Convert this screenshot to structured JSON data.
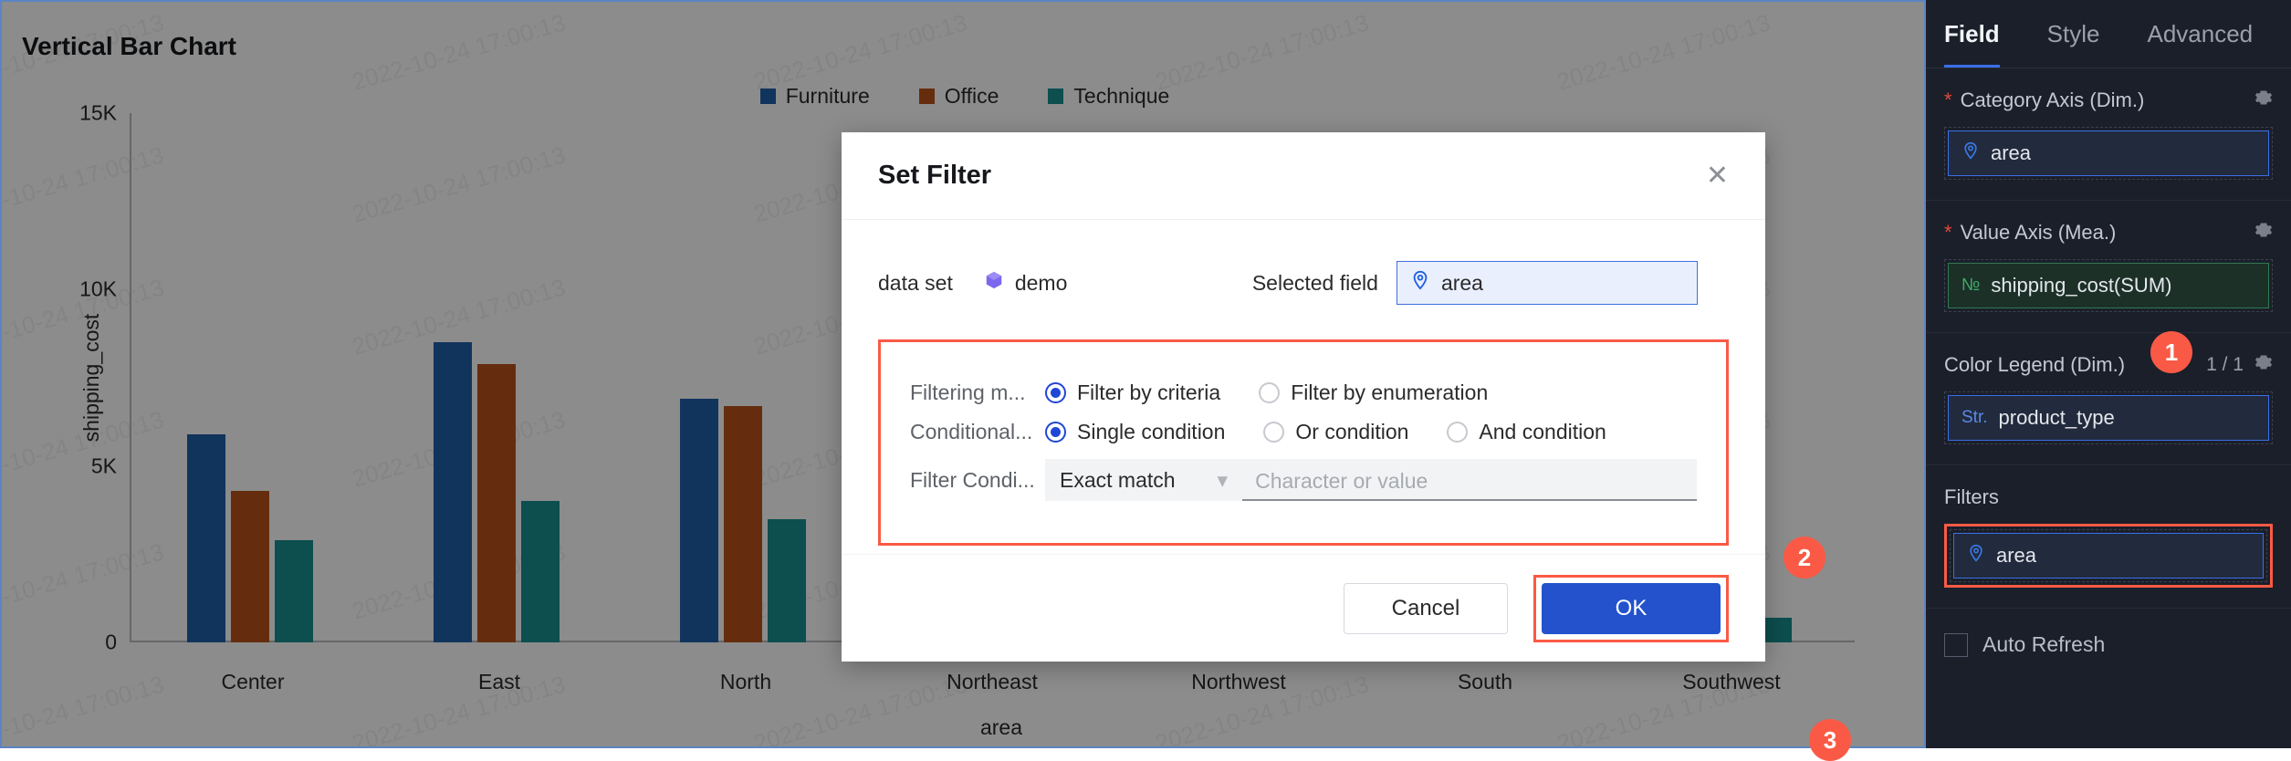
{
  "chart_panel": {
    "title": "Vertical Bar Chart",
    "watermark_text": "2022-10-24 17:00:13"
  },
  "chart_data": {
    "type": "bar",
    "title": "Vertical Bar Chart",
    "xlabel": "area",
    "ylabel": "shipping_cost",
    "ylim": [
      0,
      15000
    ],
    "yticks": [
      "0",
      "5K",
      "10K",
      "15K"
    ],
    "grid": false,
    "legend_position": "top-center",
    "categories": [
      "Center",
      "East",
      "North",
      "Northeast",
      "Northwest",
      "South",
      "Southwest"
    ],
    "series": [
      {
        "name": "Furniture",
        "color": "#1f5fa9",
        "values": [
          5900,
          8500,
          6900,
          0,
          0,
          0,
          0
        ]
      },
      {
        "name": "Office",
        "color": "#b8531a",
        "values": [
          4300,
          7900,
          6700,
          0,
          0,
          0,
          0
        ]
      },
      {
        "name": "Technique",
        "color": "#188e8e",
        "values": [
          2900,
          4000,
          3500,
          0,
          0,
          0,
          700
        ]
      }
    ]
  },
  "modal": {
    "title": "Set Filter",
    "close_icon": "close-icon",
    "dataset_label": "data set",
    "dataset_icon": "cube-icon",
    "dataset_value": "demo",
    "selected_field_label": "Selected field",
    "selected_field_icon": "location-pin-icon",
    "selected_field_value": "area",
    "filtering_mode_label": "Filtering m...",
    "filtering_mode_options": [
      "Filter by criteria",
      "Filter by enumeration"
    ],
    "filtering_mode_selected": "Filter by criteria",
    "conditional_label": "Conditional...",
    "conditional_options": [
      "Single condition",
      "Or condition",
      "And condition"
    ],
    "conditional_selected": "Single condition",
    "filter_condition_label": "Filter Condi...",
    "filter_condition_select": "Exact match",
    "filter_condition_chevron": "chevron-down-icon",
    "filter_condition_placeholder": "Character or value",
    "filter_condition_value": "",
    "cancel_label": "Cancel",
    "ok_label": "OK"
  },
  "badges": {
    "one": "1",
    "two": "2",
    "three": "3"
  },
  "sidebar": {
    "tabs": [
      {
        "label": "Field",
        "active": true
      },
      {
        "label": "Style",
        "active": false
      },
      {
        "label": "Advanced",
        "active": false
      }
    ],
    "sections": [
      {
        "title": "Category Axis (Dim.)",
        "required": true,
        "count": "",
        "chip_label": "area",
        "chip_tag": "",
        "chip_icon": "location-pin-icon",
        "chip_kind": "dim"
      },
      {
        "title": "Value Axis (Mea.)",
        "required": true,
        "count": "",
        "chip_label": "shipping_cost(SUM)",
        "chip_tag": "№",
        "chip_icon": "number-icon",
        "chip_kind": "mea"
      },
      {
        "title": "Color Legend (Dim.)",
        "required": false,
        "count": "1 / 1",
        "chip_label": "product_type",
        "chip_tag": "Str.",
        "chip_icon": "string-icon",
        "chip_kind": "dim"
      },
      {
        "title": "Filters",
        "required": false,
        "count": "",
        "chip_label": "area",
        "chip_tag": "",
        "chip_icon": "location-pin-icon",
        "chip_kind": "dim"
      }
    ],
    "auto_refresh_label": "Auto Refresh",
    "auto_refresh_checked": false,
    "gear_icon": "gear-icon"
  },
  "colors": {
    "accent_blue": "#2352cc",
    "highlight_red": "#fa5a45",
    "sidebar_bg": "#1b1f2a",
    "series_furniture": "#1f5fa9",
    "series_office": "#b8531a",
    "series_technique": "#188e8e"
  }
}
